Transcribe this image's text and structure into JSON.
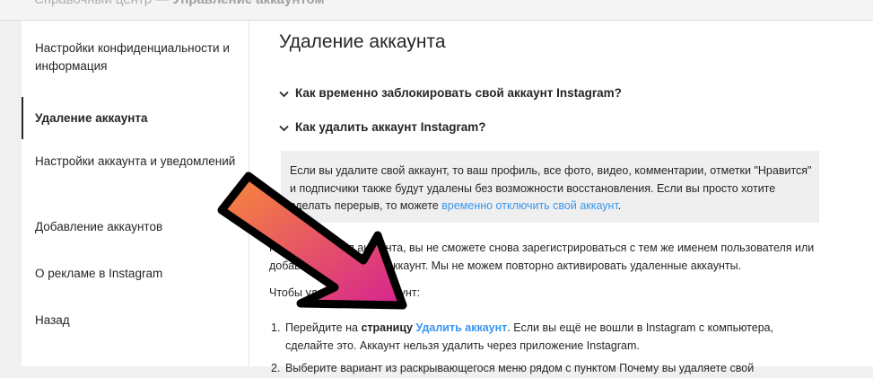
{
  "topbar": {
    "crumb_prefix": "Справочный центр —",
    "crumb_current": "Управление аккаунтом"
  },
  "sidebar": {
    "items": [
      {
        "label": "Настройки конфиденциальности и информация"
      },
      {
        "label": "Удаление аккаунта",
        "active": true
      },
      {
        "label": "Настройки аккаунта и уведомлений"
      },
      {
        "label": "Добавление аккаунтов"
      },
      {
        "label": "О рекламе в Instagram"
      },
      {
        "label": "Назад"
      }
    ]
  },
  "main": {
    "title": "Удаление аккаунта",
    "faq": [
      {
        "question": "Как временно заблокировать свой аккаунт Instagram?",
        "icon": "chevron-down-icon"
      },
      {
        "question": "Как удалить аккаунт Instagram?",
        "icon": "chevron-down-icon"
      }
    ],
    "info_box": {
      "text": "Если вы удалите свой аккаунт, то ваш профиль, все фото, видео, комментарии, отметки \"Нравится\" и подписчики также будут удалены без возможности восстановления. Если вы просто хотите сделать перерыв, то можете ",
      "link": "временно отключить свой аккаунт",
      "suffix": "."
    },
    "para1_a": "После удаления аккаунта, вы не сможете снова зарегистрироваться с тем же именем пользователя или",
    "para1_b": "добавить его в другой аккаунт. Мы не можем повторно активировать удаленные аккаунты.",
    "para2": "Чтобы удалить свой аккаунт:",
    "steps": [
      {
        "num": "1.",
        "prefix": "Перейдите на ",
        "bold": "страницу",
        "link": "Удалить аккаунт",
        "rest": ". Если вы ещё не вошли в Instagram с компьютера, сделайте это. Аккаунт нельзя удалить через приложение Instagram."
      },
      {
        "num": "2.",
        "text": "Выберите вариант из раскрывающегося меню рядом с пунктом Почему вы удаляете свой"
      }
    ]
  },
  "colors": {
    "link": "#3897f0",
    "arrow_start": "#f7893a",
    "arrow_end": "#d6248f",
    "info_bg": "#efefef"
  }
}
